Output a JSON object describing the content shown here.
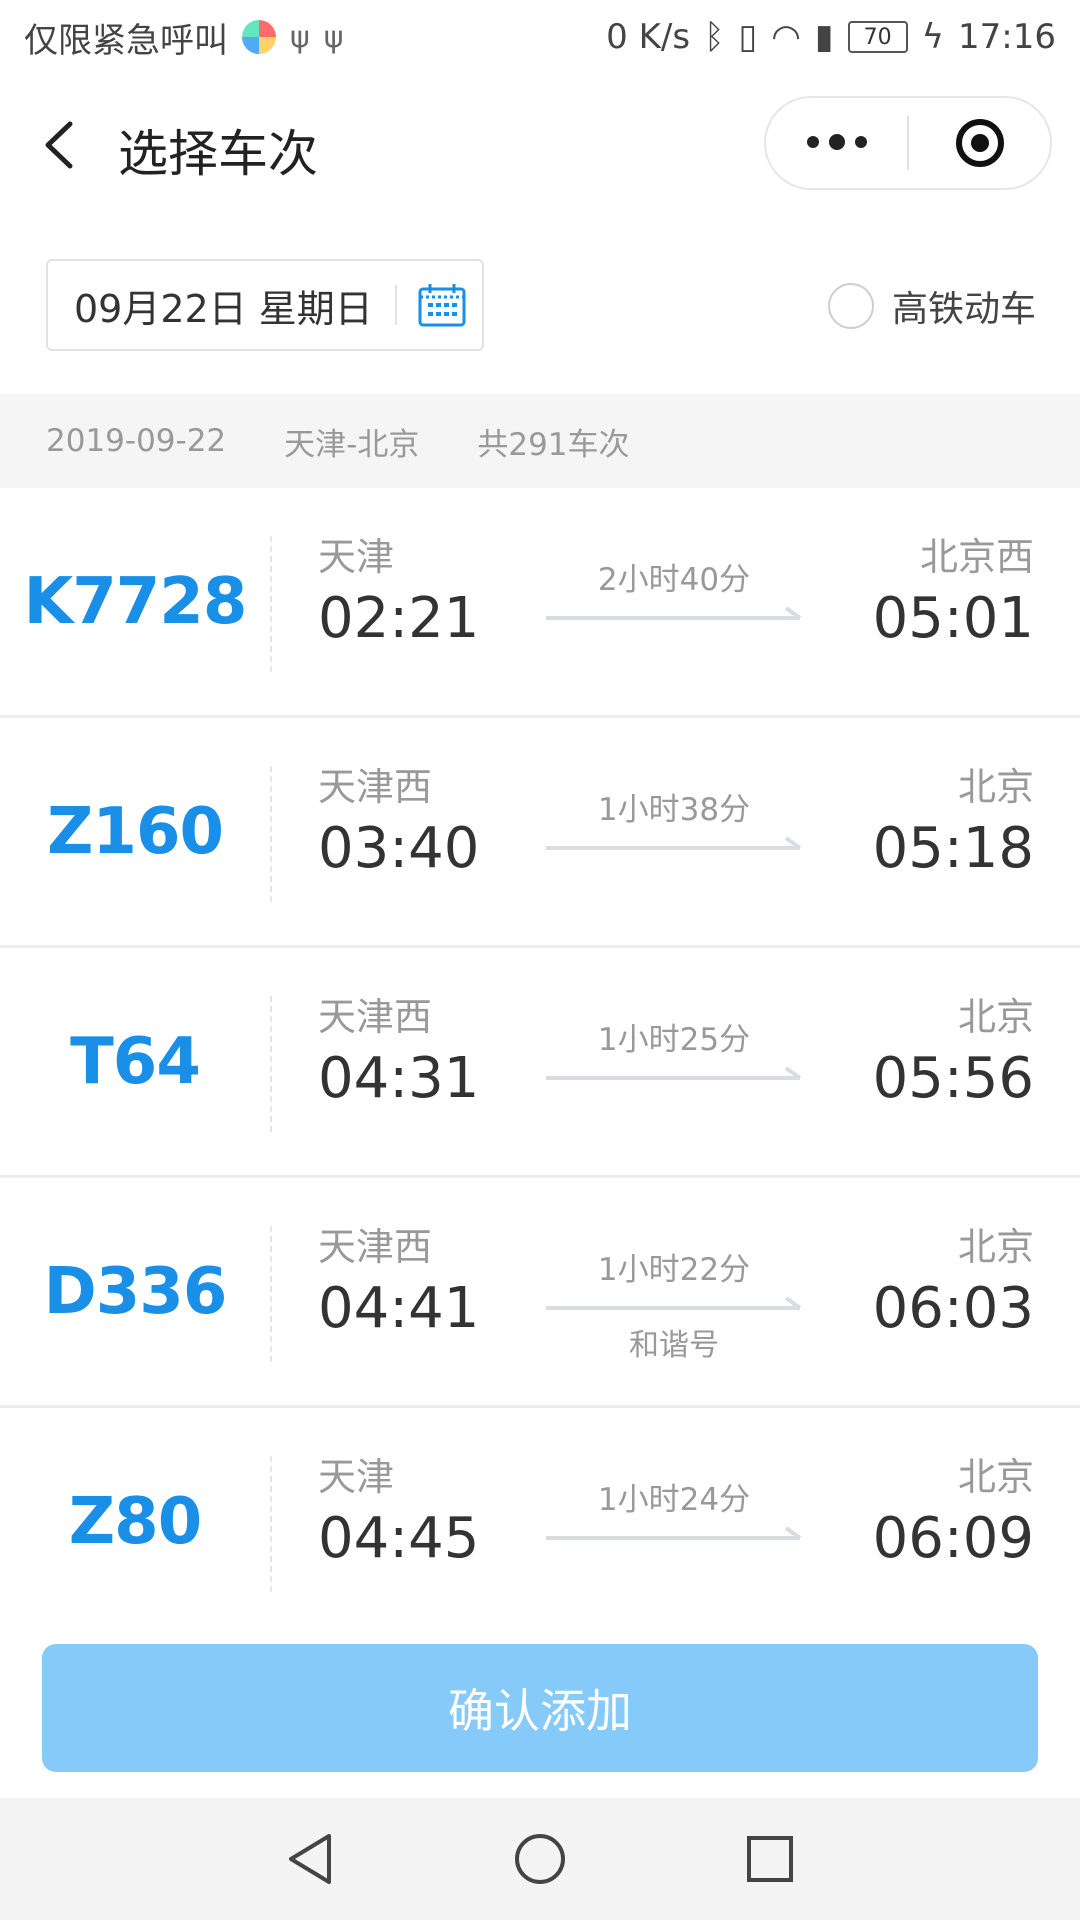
{
  "status_bar": {
    "left_text": "仅限紧急呼叫",
    "network_speed": "0 K/s",
    "battery": "70",
    "time": "17:16"
  },
  "header": {
    "title": "选择车次"
  },
  "filters": {
    "date_label": "09月22日 星期日",
    "high_speed_label": "高铁动车"
  },
  "summary": {
    "date": "2019-09-22",
    "route": "天津-北京",
    "count": "共291车次"
  },
  "trains": [
    {
      "train_no": "K7728",
      "from": "天津",
      "dep_time": "02:21",
      "duration": "2小时40分",
      "to": "北京西",
      "arr_time": "05:01",
      "subtype": ""
    },
    {
      "train_no": "Z160",
      "from": "天津西",
      "dep_time": "03:40",
      "duration": "1小时38分",
      "to": "北京",
      "arr_time": "05:18",
      "subtype": ""
    },
    {
      "train_no": "T64",
      "from": "天津西",
      "dep_time": "04:31",
      "duration": "1小时25分",
      "to": "北京",
      "arr_time": "05:56",
      "subtype": ""
    },
    {
      "train_no": "D336",
      "from": "天津西",
      "dep_time": "04:41",
      "duration": "1小时22分",
      "to": "北京",
      "arr_time": "06:03",
      "subtype": "和谐号"
    },
    {
      "train_no": "Z80",
      "from": "天津",
      "dep_time": "04:45",
      "duration": "1小时24分",
      "to": "北京",
      "arr_time": "06:09",
      "subtype": ""
    }
  ],
  "footer": {
    "confirm_label": "确认添加"
  },
  "colors": {
    "accent": "#1a8fe8",
    "button": "#86cafa"
  }
}
